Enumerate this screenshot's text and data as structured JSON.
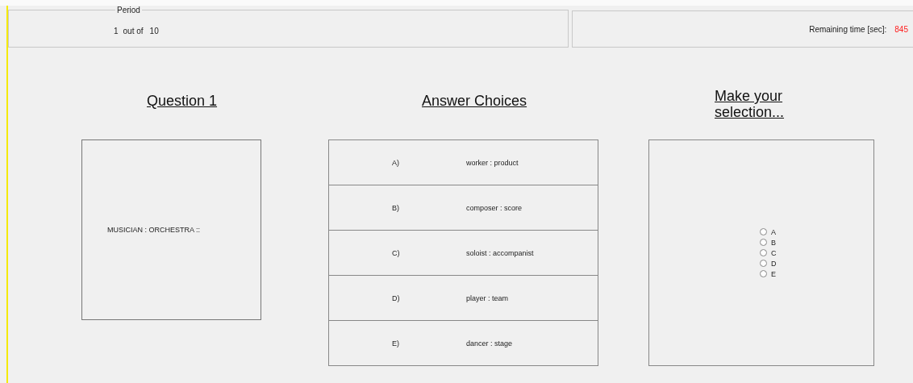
{
  "period": {
    "legend": "Period",
    "current": "1",
    "separator": "out of",
    "total": "10"
  },
  "timer": {
    "label": "Remaining time [sec]:",
    "value": "845"
  },
  "question": {
    "heading": "Question 1",
    "prompt": "MUSICIAN : ORCHESTRA ::"
  },
  "answers": {
    "heading": "Answer Choices",
    "choices": [
      {
        "letter": "A)",
        "text": "worker : product"
      },
      {
        "letter": "B)",
        "text": "composer : score"
      },
      {
        "letter": "C)",
        "text": "soloist : accompanist"
      },
      {
        "letter": "D)",
        "text": "player : team"
      },
      {
        "letter": "E)",
        "text": "dancer : stage"
      }
    ]
  },
  "selection": {
    "heading": "Make your selection...",
    "options": [
      {
        "label": "A",
        "selected": false
      },
      {
        "label": "B",
        "selected": false
      },
      {
        "label": "C",
        "selected": false
      },
      {
        "label": "D",
        "selected": false
      },
      {
        "label": "E",
        "selected": false
      }
    ]
  }
}
